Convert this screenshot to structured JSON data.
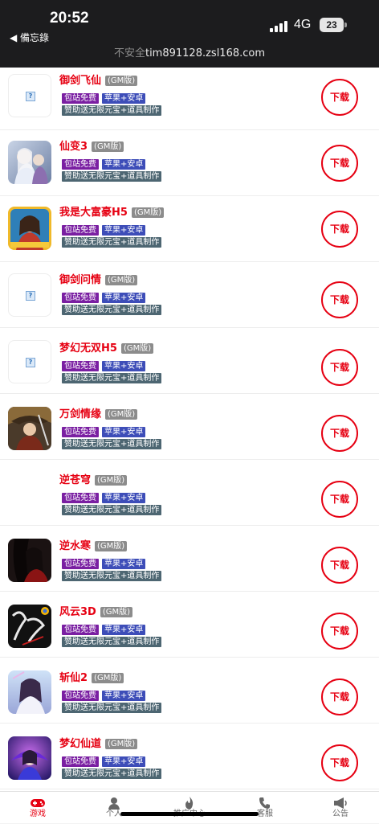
{
  "status": {
    "time": "20:52",
    "back_label": "◀ 備忘錄",
    "network": "4G",
    "battery": "23"
  },
  "browser": {
    "insecure_label": "不安全",
    "host": "tim891128.zsl168.com"
  },
  "colors": {
    "accent": "#e60012",
    "tag_free": "#7a1fa2",
    "tag_platform": "#3d4db8",
    "tag_gift": "#4d6672",
    "gm_badge": "#8c8c8c"
  },
  "games": [
    {
      "title": "御剑飞仙",
      "badge": "(GM版)",
      "tag_free": "包站免费",
      "tag_platform": "苹果+安卓",
      "tag_gift": "赞助送无限元宝+道具制作",
      "download": "下载",
      "icon": "broken-image-icon"
    },
    {
      "title": "仙变3",
      "badge": "(GM版)",
      "tag_free": "包站免费",
      "tag_platform": "苹果+安卓",
      "tag_gift": "赞助送无限元宝+道具制作",
      "download": "下载",
      "icon": "xianbian3-icon"
    },
    {
      "title": "我是大富豪H5",
      "badge": "(GM版)",
      "tag_free": "包站免费",
      "tag_platform": "苹果+安卓",
      "tag_gift": "赞助送无限元宝+道具制作",
      "download": "下载",
      "icon": "dafuhao-icon"
    },
    {
      "title": "御剑问情",
      "badge": "(GM版)",
      "tag_free": "包站免费",
      "tag_platform": "苹果+安卓",
      "tag_gift": "赞助送无限元宝+道具制作",
      "download": "下载",
      "icon": "broken-image-icon"
    },
    {
      "title": "梦幻无双H5",
      "badge": "(GM版)",
      "tag_free": "包站免费",
      "tag_platform": "苹果+安卓",
      "tag_gift": "赞助送无限元宝+道具制作",
      "download": "下载",
      "icon": "broken-image-icon"
    },
    {
      "title": "万剑情缘",
      "badge": "(GM版)",
      "tag_free": "包站免费",
      "tag_platform": "苹果+安卓",
      "tag_gift": "赞助送无限元宝+道具制作",
      "download": "下载",
      "icon": "wanjian-icon"
    },
    {
      "title": "逆苍穹",
      "badge": "(GM版)",
      "tag_free": "包站免费",
      "tag_platform": "苹果+安卓",
      "tag_gift": "赞助送无限元宝+道具制作",
      "download": "下载",
      "icon": "none"
    },
    {
      "title": "逆水寒",
      "badge": "(GM版)",
      "tag_free": "包站免费",
      "tag_platform": "苹果+安卓",
      "tag_gift": "赞助送无限元宝+道具制作",
      "download": "下载",
      "icon": "nishuihan-icon"
    },
    {
      "title": "风云3D",
      "badge": "(GM版)",
      "tag_free": "包站免费",
      "tag_platform": "苹果+安卓",
      "tag_gift": "赞助送无限元宝+道具制作",
      "download": "下载",
      "icon": "fengyun-icon"
    },
    {
      "title": "斩仙2",
      "badge": "(GM版)",
      "tag_free": "包站免费",
      "tag_platform": "苹果+安卓",
      "tag_gift": "赞助送无限元宝+道具制作",
      "download": "下载",
      "icon": "zhanxian-icon"
    },
    {
      "title": "梦幻仙道",
      "badge": "(GM版)",
      "tag_free": "包站免费",
      "tag_platform": "苹果+安卓",
      "tag_gift": "赞助送无限元宝+道具制作",
      "download": "下载",
      "icon": "menghuan-icon"
    }
  ],
  "tabs": [
    {
      "label": "游戏",
      "icon": "gamepad-icon",
      "active": true
    },
    {
      "label": "个人",
      "icon": "person-icon",
      "active": false
    },
    {
      "label": "推广中心",
      "icon": "flame-icon",
      "active": false
    },
    {
      "label": "客服",
      "icon": "phone-icon",
      "active": false
    },
    {
      "label": "公告",
      "icon": "megaphone-icon",
      "active": false
    }
  ]
}
